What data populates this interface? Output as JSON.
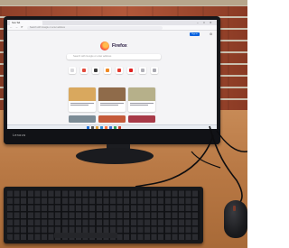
{
  "photo": {
    "subject": "desktop-computer",
    "monitor_brand": "Lenovo"
  },
  "browser": {
    "tab_label": "New Tab",
    "window_controls": [
      "–",
      "□",
      "✕"
    ],
    "nav": {
      "back": "←",
      "forward": "→",
      "reload": "⟳"
    },
    "url_placeholder": "Search with Google or enter address",
    "sign_in_label": "Sign in",
    "settings_icon": "gear-icon",
    "logo_wordmark": "Firefox",
    "search_placeholder": "Search with Google or enter address",
    "shortcuts": [
      {
        "label": "",
        "color": "#d8d8dc"
      },
      {
        "label": "",
        "color": "#e34a3c"
      },
      {
        "label": "",
        "color": "#3a3a3a"
      },
      {
        "label": "",
        "color": "#f08a24"
      },
      {
        "label": "",
        "color": "#e43a2e"
      },
      {
        "label": "",
        "color": "#e02020"
      },
      {
        "label": "",
        "color": "#b0b0b8"
      },
      {
        "label": "",
        "color": "#a8a8b0"
      }
    ],
    "stories_heading": "",
    "cards": [
      {
        "img": "#d9a85e"
      },
      {
        "img": "#8f6b4a"
      },
      {
        "img": "#b6b08a"
      }
    ]
  },
  "colors": {
    "accent": "#0061e0",
    "wall": "#a04a30",
    "desk": "#b87844"
  }
}
